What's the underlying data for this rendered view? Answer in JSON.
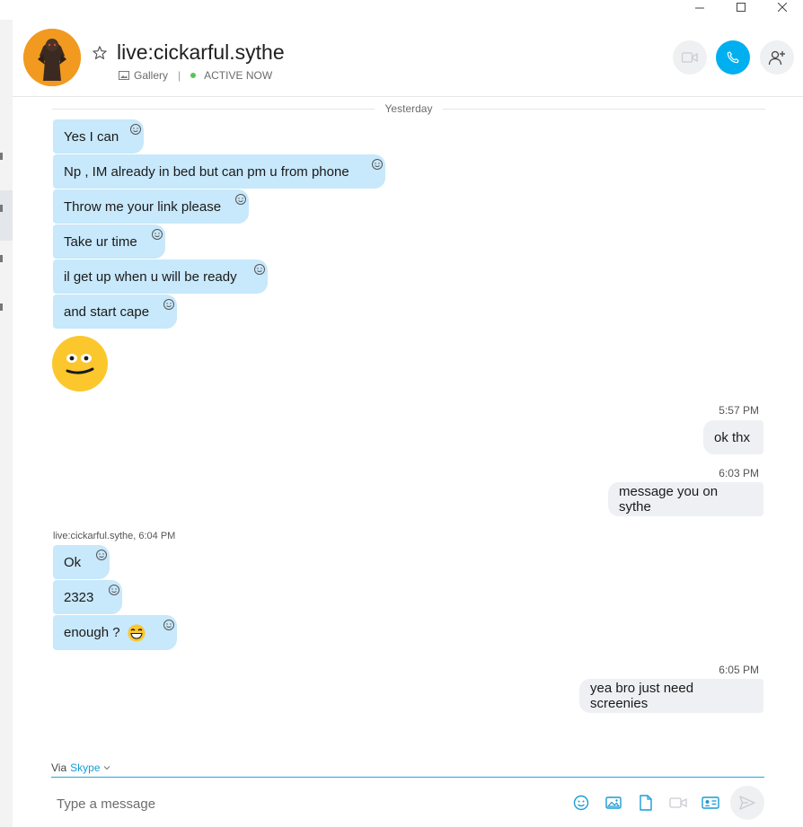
{
  "contact": {
    "name": "live:cickarful.sythe",
    "gallery_label": "Gallery",
    "status_label": "ACTIVE NOW"
  },
  "colors": {
    "accent": "#00aff0",
    "incoming_bubble": "#c8e8fb",
    "outgoing_bubble": "#eef0f3",
    "active_status": "#5bc25b"
  },
  "conversation": {
    "day_divider": "Yesterday",
    "group1": [
      {
        "text": "Yes I can"
      },
      {
        "text": "Np , IM already in bed but can pm  u from phone"
      },
      {
        "text": "Throw me your link please"
      },
      {
        "text": "Take ur time"
      },
      {
        "text": "il get up when u will be ready"
      },
      {
        "text": "and start cape"
      }
    ],
    "big_emoji": "smiley-emoji",
    "outgoing1": {
      "time": "5:57 PM",
      "text": "ok thx"
    },
    "outgoing2": {
      "time": "6:03 PM",
      "text": "message you on sythe"
    },
    "sender_line": "live:cickarful.sythe, 6:04 PM",
    "group2": [
      {
        "text": "Ok"
      },
      {
        "text": "2323"
      },
      {
        "text": "enough ?"
      }
    ],
    "outgoing3": {
      "time": "6:05 PM",
      "text": "yea bro just need screenies"
    }
  },
  "composer": {
    "via_label": "Via",
    "via_service": "Skype",
    "placeholder": "Type a message"
  },
  "icons": [
    "star-icon",
    "gallery-icon",
    "video-call-icon",
    "phone-icon",
    "add-user-icon",
    "reaction-icon",
    "emoji-icon",
    "image-icon",
    "file-icon",
    "video-message-icon",
    "contact-card-icon",
    "send-icon",
    "chevron-down-icon"
  ]
}
